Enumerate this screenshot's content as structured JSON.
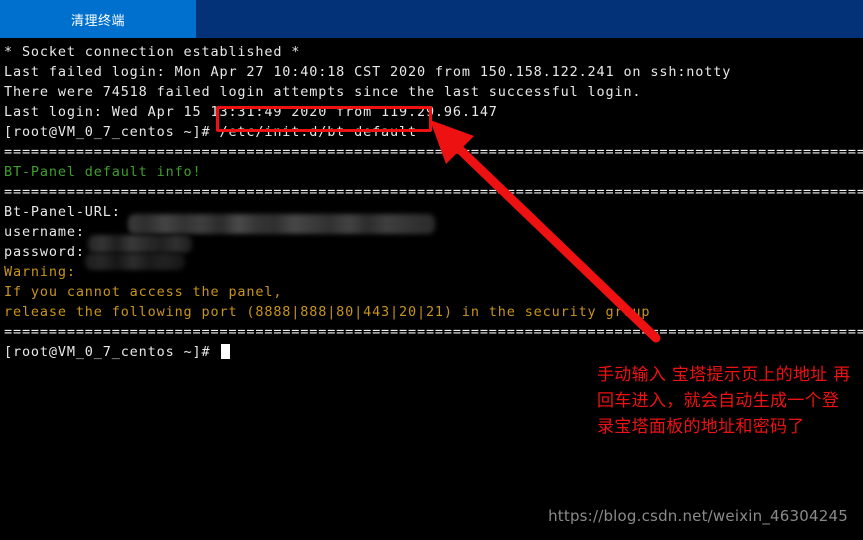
{
  "titlebar": {
    "tab_label": "清理终端"
  },
  "terminal": {
    "lines": [
      {
        "text": "* Socket connection established *",
        "color": "white"
      },
      {
        "text": "Last failed login: Mon Apr 27 10:40:18 CST 2020 from 150.158.122.241 on ssh:notty",
        "color": "white"
      },
      {
        "text": "There were 74518 failed login attempts since the last successful login.",
        "color": "white"
      },
      {
        "text": "Last login: Wed Apr 15 13:31:49 2020 from 119.29.96.147",
        "color": "white"
      },
      {
        "text": "[root@VM_0_7_centos ~]# /etc/init.d/bt default",
        "color": "white"
      },
      {
        "text": "==================================================================================================",
        "color": "sep"
      },
      {
        "text": "BT-Panel default info!",
        "color": "green"
      },
      {
        "text": "==================================================================================================",
        "color": "sep"
      },
      {
        "text": "Bt-Panel-URL:",
        "color": "white"
      },
      {
        "text": "username:",
        "color": "white"
      },
      {
        "text": "password:",
        "color": "white"
      },
      {
        "text": "Warning:",
        "color": "yellow"
      },
      {
        "text": "If you cannot access the panel,",
        "color": "yellow"
      },
      {
        "text": "release the following port (8888|888|80|443|20|21) in the security group",
        "color": "yellow"
      },
      {
        "text": "==================================================================================================",
        "color": "sep"
      },
      {
        "text": "[root@VM_0_7_centos ~]# ",
        "color": "white",
        "cursor": true
      }
    ],
    "prompt_command": "/etc/init.d/bt default",
    "redacted_fields": [
      "Bt-Panel-URL",
      "username",
      "password"
    ]
  },
  "annotation": {
    "text": "手动输入 宝塔提示页上的地址 再回车进入，就会自动生成一个登录宝塔面板的地址和密码了",
    "color": "#ee1111"
  },
  "highlight": {
    "color": "#ee1111",
    "target_text": "/etc/init.d/bt default"
  },
  "watermark": {
    "text": "https://blog.csdn.net/weixin_46304245"
  },
  "colors": {
    "tab_active": "#0070ce",
    "titlebar": "#033279",
    "terminal_bg": "#000000",
    "terminal_fg": "#e8e8e8",
    "green": "#3f9f2b",
    "yellow": "#c8941a",
    "accent_red": "#ee1111",
    "watermark": "#8a8a8a"
  }
}
